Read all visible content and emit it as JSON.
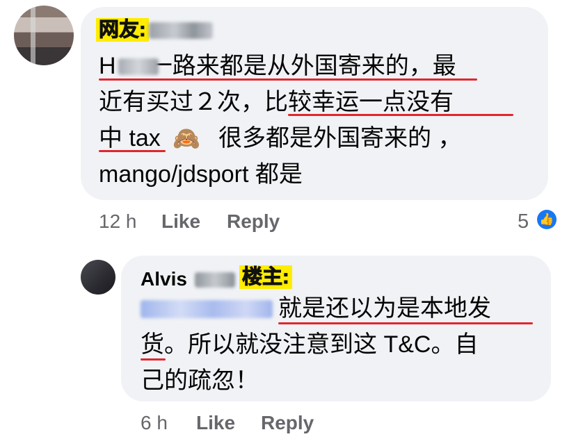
{
  "comment": {
    "tag": "网友:",
    "body_lines": [
      "H     一路来都是从外国寄来的，最",
      "近有买过２次，比较幸运一点没有",
      "中 tax",
      "mango/jdsport 都是"
    ],
    "line3_tail": "很多都是外国寄来的 ，",
    "emoji": "🙈",
    "time": "12 h",
    "like_label": "Like",
    "reply_label": "Reply",
    "reaction_count": "5",
    "reaction_icon": "thumbs-up-icon"
  },
  "reply": {
    "author": "Alvis",
    "tag": "楼主:",
    "body_lines": [
      "就是还以为是本地发",
      "货。所以就没注意到这 T&C。自",
      "己的疏忽！"
    ],
    "time": "6 h",
    "like_label": "Like",
    "reply_label": "Reply"
  },
  "colors": {
    "bubble": "#f0f2f5",
    "tag_bg": "#ffec00",
    "underline": "#e0262d",
    "meta": "#65676b",
    "like_blue": "#1877f2"
  }
}
